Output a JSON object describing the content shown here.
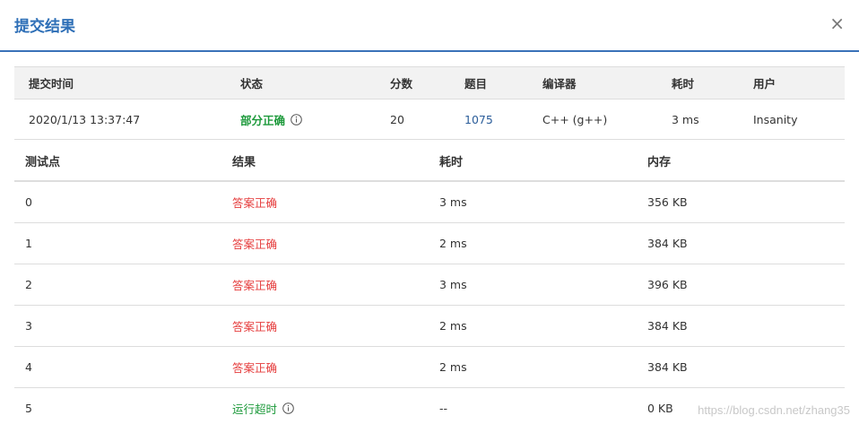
{
  "dialog": {
    "title": "提交结果",
    "close_glyph": "×"
  },
  "summary": {
    "headers": [
      "提交时间",
      "状态",
      "分数",
      "题目",
      "编译器",
      "耗时",
      "用户"
    ],
    "row": {
      "time": "2020/1/13 13:37:47",
      "status": "部分正确",
      "score": "20",
      "problem": "1075",
      "compiler": "C++ (g++)",
      "elapsed": "3 ms",
      "user": "Insanity"
    }
  },
  "tests": {
    "headers": [
      "测试点",
      "结果",
      "耗时",
      "内存"
    ],
    "rows": [
      {
        "id": "0",
        "result": "答案正确",
        "time": "3 ms",
        "memory": "356 KB"
      },
      {
        "id": "1",
        "result": "答案正确",
        "time": "2 ms",
        "memory": "384 KB"
      },
      {
        "id": "2",
        "result": "答案正确",
        "time": "3 ms",
        "memory": "396 KB"
      },
      {
        "id": "3",
        "result": "答案正确",
        "time": "2 ms",
        "memory": "384 KB"
      },
      {
        "id": "4",
        "result": "答案正确",
        "time": "2 ms",
        "memory": "384 KB"
      },
      {
        "id": "5",
        "result": "运行超时",
        "time": "--",
        "memory": "0 KB"
      }
    ]
  },
  "watermark": "https://blog.csdn.net/zhang35",
  "colors": {
    "accent": "#3a72b8",
    "pass": "#e53c3c",
    "partial": "#1e9a3c"
  },
  "icons": {
    "info": "info-circle-icon",
    "close": "close-icon"
  }
}
